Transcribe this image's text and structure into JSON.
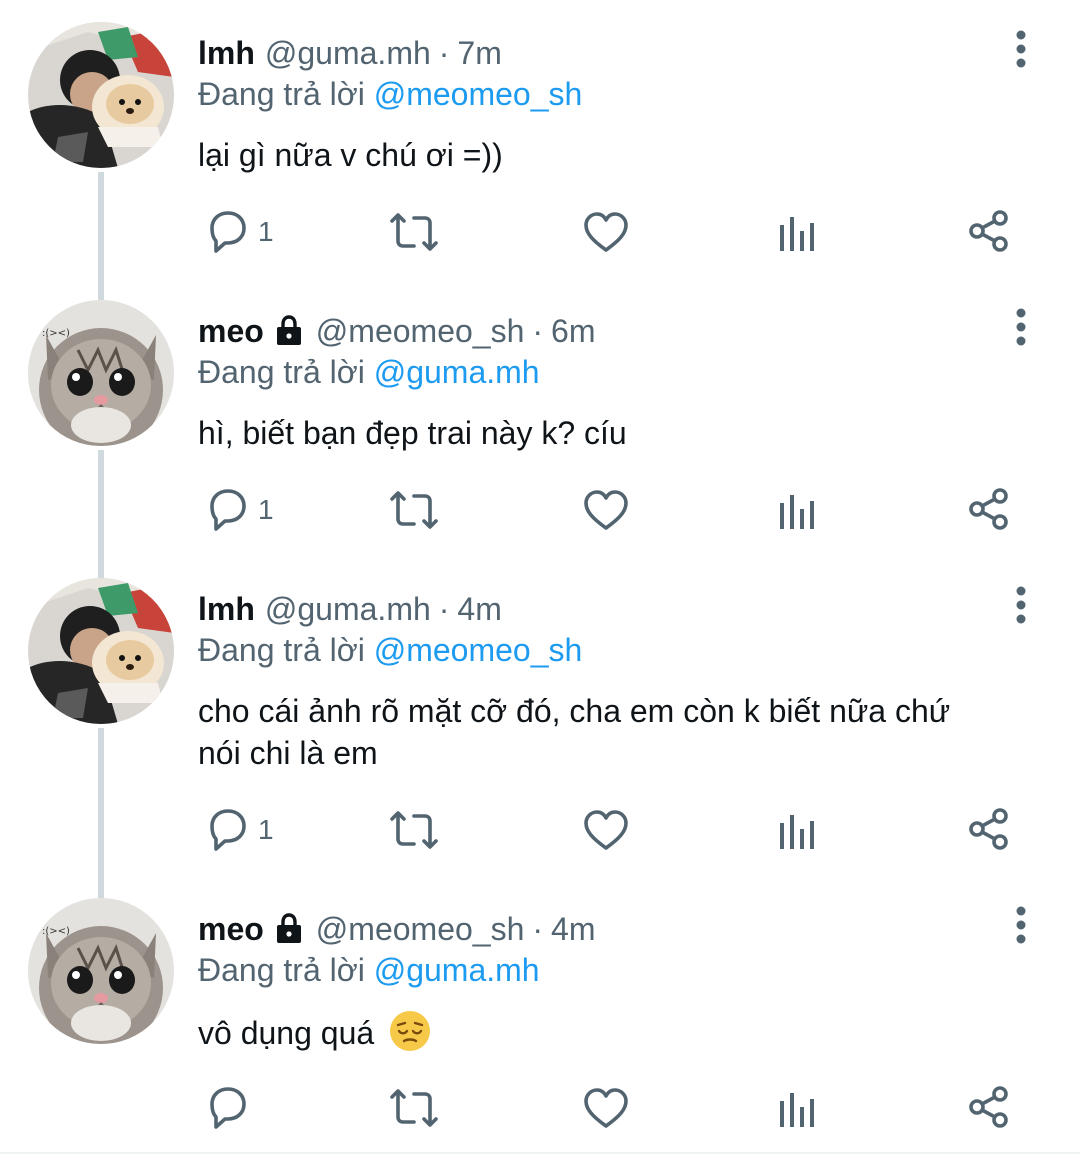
{
  "tweets": [
    {
      "name": "lmh",
      "handle": "@guma.mh",
      "dot": "·",
      "time": "7m",
      "replying_prefix": "Đang trả lời",
      "replying_to": "@meomeo_sh",
      "text": "lại gì nữa v chú ơi =))",
      "reply_count": "1",
      "locked": false,
      "avatar": "man-with-dog-avatar"
    },
    {
      "name": "meo",
      "handle": "@meomeo_sh",
      "dot": "·",
      "time": "6m",
      "replying_prefix": "Đang trả lời",
      "replying_to": "@guma.mh",
      "text": "hì, biết bạn đẹp trai này k? cíu",
      "reply_count": "1",
      "locked": true,
      "avatar": "kitten-avatar"
    },
    {
      "name": "lmh",
      "handle": "@guma.mh",
      "dot": "·",
      "time": "4m",
      "replying_prefix": "Đang trả lời",
      "replying_to": "@meomeo_sh",
      "text_line1": "cho cái ảnh rõ mặt cỡ đó, cha em còn k biết nữa chứ",
      "text_line2": "nói chi là em",
      "reply_count": "1",
      "locked": false,
      "avatar": "man-with-dog-avatar"
    },
    {
      "name": "meo",
      "handle": "@meomeo_sh",
      "dot": "·",
      "time": "4m",
      "replying_prefix": "Đang trả lời",
      "replying_to": "@guma.mh",
      "text": "vô dụng quá",
      "emoji": "pensive-face-emoji",
      "reply_count": "",
      "locked": true,
      "avatar": "kitten-avatar"
    }
  ],
  "icons": {
    "reply": "reply-icon",
    "retweet": "retweet-icon",
    "like": "heart-icon",
    "views": "views-icon",
    "share": "share-icon",
    "more": "more-vertical-icon",
    "lock": "lock-icon"
  },
  "colors": {
    "text": "#0f1419",
    "secondary": "#536471",
    "mention": "#1d9bf0",
    "thread_line": "#cfd9de"
  }
}
